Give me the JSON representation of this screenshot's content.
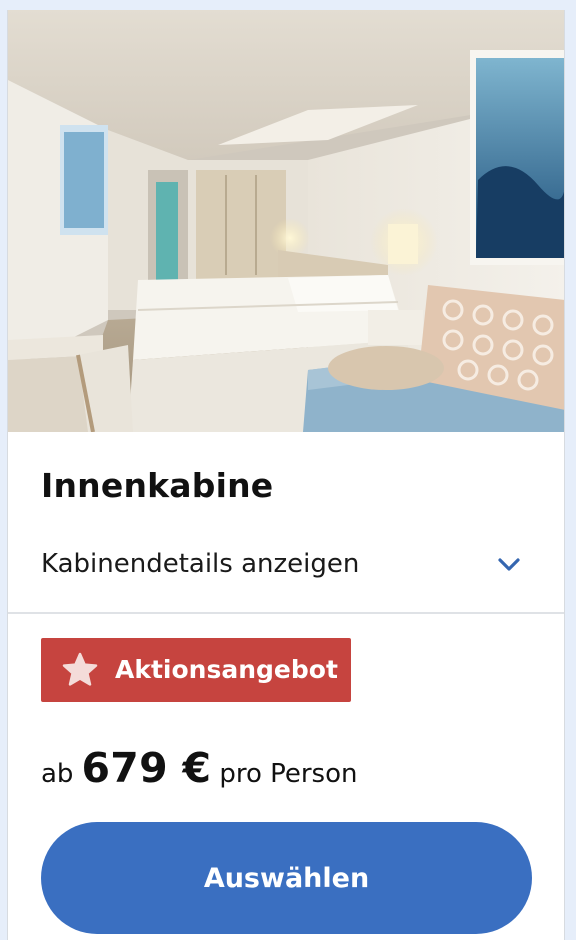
{
  "cabin": {
    "photo_alt": "Innenkabine",
    "title": "Innenkabine",
    "details_label": "Kabinendetails anzeigen",
    "details_icon": "chevron-down-icon"
  },
  "offer": {
    "badge_icon": "star-icon",
    "badge_label": "Aktionsangebot"
  },
  "price": {
    "prefix": "ab",
    "amount": "679 €",
    "suffix": "pro Person"
  },
  "action": {
    "select_label": "Auswählen"
  },
  "colors": {
    "accent": "#3a6fc1",
    "badge": "#c6443f",
    "page_background": "#e6eefa",
    "chevron": "#3566b0"
  }
}
